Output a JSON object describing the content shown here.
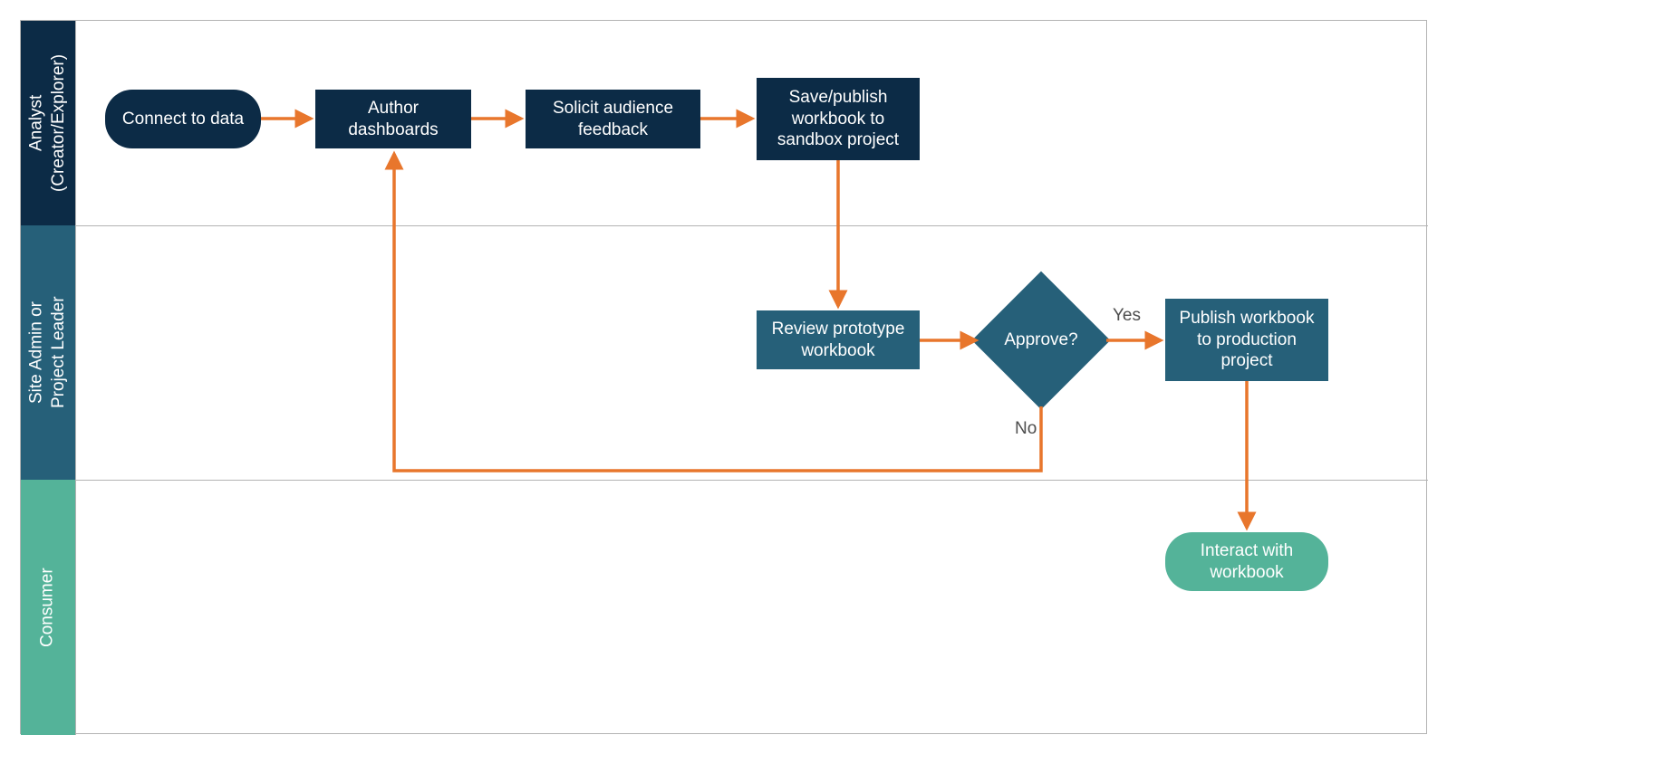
{
  "swimlanes": {
    "lane1": "Analyst\n(Creator/Explorer)",
    "lane2": "Site Admin or\nProject Leader",
    "lane3": "Consumer"
  },
  "nodes": {
    "connect": "Connect to data",
    "author": "Author dashboards",
    "solicit": "Solicit audience feedback",
    "save": "Save/publish workbook to sandbox project",
    "review": "Review prototype workbook",
    "approve": "Approve?",
    "publish": "Publish workbook to production project",
    "interact": "Interact with workbook"
  },
  "labels": {
    "yes": "Yes",
    "no": "No"
  },
  "colors": {
    "arrow": "#e8762c",
    "lane1": "#0c2b46",
    "lane2": "#266079",
    "lane3": "#54b399"
  }
}
